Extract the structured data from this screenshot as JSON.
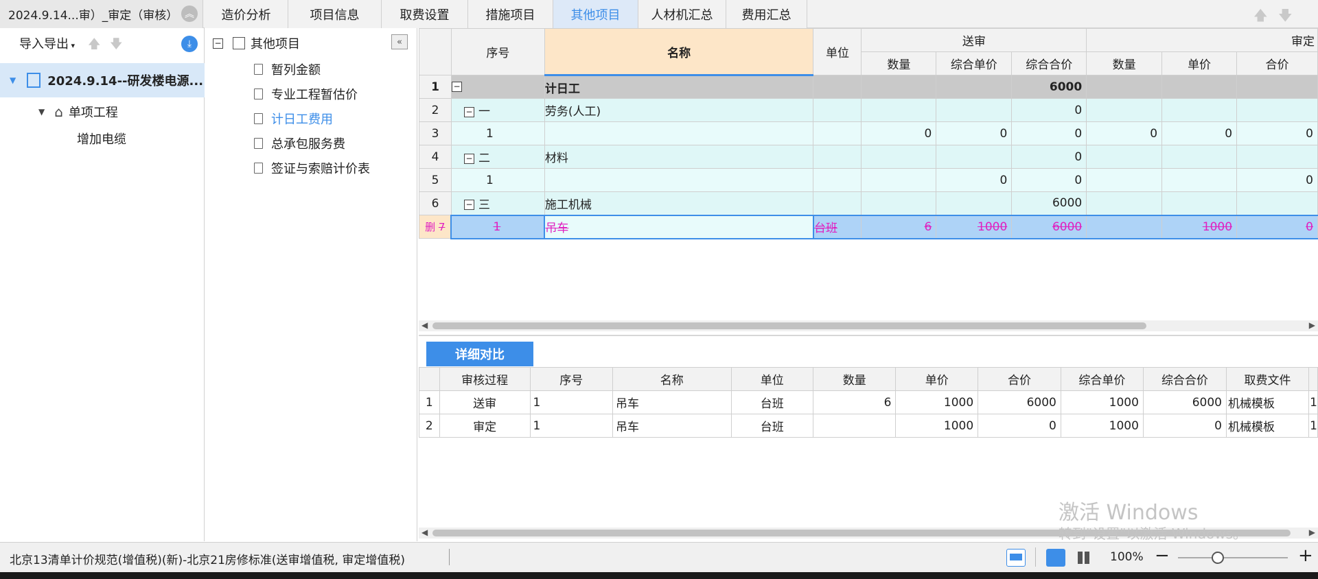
{
  "header": {
    "project_title": "2024.9.14...审）_审定（审核）",
    "tabs": [
      "造价分析",
      "项目信息",
      "取费设置",
      "措施项目",
      "其他项目",
      "人材机汇总",
      "费用汇总"
    ],
    "active_tab": "其他项目"
  },
  "left_panel": {
    "import_export": "导入导出",
    "project_node": "2024.9.14--研发楼电源...",
    "sub_node": "单项工程",
    "leaf_node": "增加电缆"
  },
  "tree": {
    "root": "其他项目",
    "items": [
      "暂列金额",
      "专业工程暂估价",
      "计日工费用",
      "总承包服务费",
      "签证与索赔计价表"
    ],
    "active_item": "计日工费用"
  },
  "main_grid": {
    "headers": {
      "seq": "序号",
      "name": "名称",
      "unit": "单位",
      "submit_group": "送审",
      "approve_group": "审定",
      "qty": "数量",
      "comp_price": "综合单价",
      "comp_total": "综合合价",
      "approve_qty": "数量",
      "approve_price": "单价",
      "approve_total": "合价"
    },
    "rows": [
      {
        "rownum": "1",
        "seq": "",
        "name": "计日工",
        "unit": "",
        "qty": "",
        "price": "",
        "total": "6000",
        "aqty": "",
        "aprice": "",
        "atotal": ""
      },
      {
        "rownum": "2",
        "seq": "一",
        "name": "劳务(人工)",
        "unit": "",
        "qty": "",
        "price": "",
        "total": "0",
        "aqty": "",
        "aprice": "",
        "atotal": ""
      },
      {
        "rownum": "3",
        "seq": "1",
        "name": "",
        "unit": "",
        "qty": "0",
        "price": "0",
        "total": "0",
        "aqty": "0",
        "aprice": "0",
        "atotal": "0"
      },
      {
        "rownum": "4",
        "seq": "二",
        "name": "材料",
        "unit": "",
        "qty": "",
        "price": "",
        "total": "0",
        "aqty": "",
        "aprice": "",
        "atotal": ""
      },
      {
        "rownum": "5",
        "seq": "1",
        "name": "",
        "unit": "",
        "qty": "",
        "price": "0",
        "total": "0",
        "aqty": "",
        "aprice": "",
        "atotal": "0"
      },
      {
        "rownum": "6",
        "seq": "三",
        "name": "施工机械",
        "unit": "",
        "qty": "",
        "price": "",
        "total": "6000",
        "aqty": "",
        "aprice": "",
        "atotal": ""
      },
      {
        "rownum": "7",
        "del": "删",
        "seq": "1",
        "name": "吊车",
        "unit": "台班",
        "qty": "6",
        "price": "1000",
        "total": "6000",
        "aqty": "",
        "aprice": "1000",
        "atotal": "0"
      }
    ]
  },
  "detail": {
    "button": "详细对比",
    "headers": [
      "审核过程",
      "序号",
      "名称",
      "单位",
      "数量",
      "单价",
      "合价",
      "综合单价",
      "综合合价",
      "取费文件"
    ],
    "rows": [
      {
        "n": "1",
        "process": "送审",
        "seq": "1",
        "name": "吊车",
        "unit": "台班",
        "qty": "6",
        "price": "1000",
        "total": "6000",
        "cprice": "1000",
        "ctotal": "6000",
        "file": "机械模板",
        "extra": "1"
      },
      {
        "n": "2",
        "process": "审定",
        "seq": "1",
        "name": "吊车",
        "unit": "台班",
        "qty": "",
        "price": "1000",
        "total": "0",
        "cprice": "1000",
        "ctotal": "0",
        "file": "机械模板",
        "extra": "1"
      }
    ]
  },
  "watermark": {
    "line1": "激活 Windows",
    "line2": "转到\"设置\"以激活 Windows。"
  },
  "status": {
    "text": "北京13清单计价规范(增值税)(新)-北京21房修标准(送审增值税, 审定增值税)",
    "zoom": "100%"
  }
}
